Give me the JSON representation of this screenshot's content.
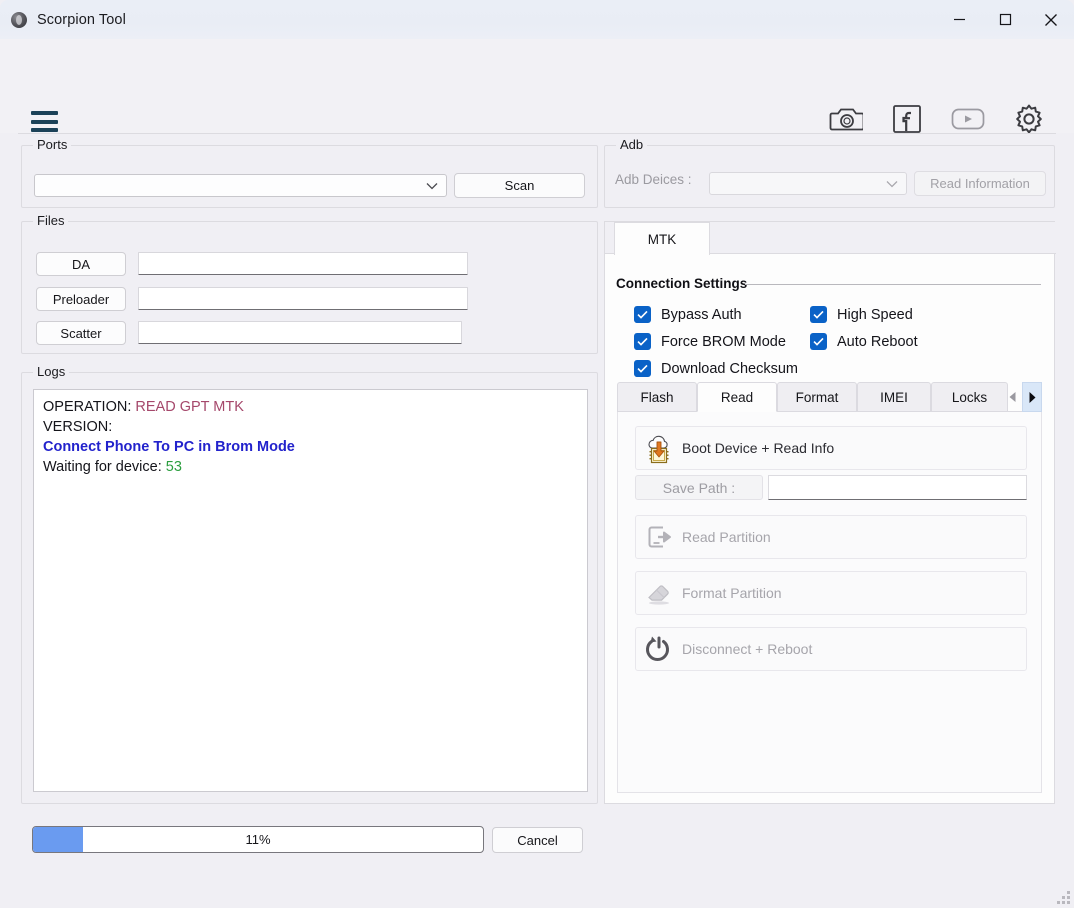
{
  "window": {
    "title": "Scorpion Tool",
    "icon": "app-logo-icon",
    "minimize": "minimize-icon",
    "maximize": "maximize-icon",
    "close": "close-icon"
  },
  "toolbar": {
    "menu_icon": "hamburger-menu-icon",
    "icons": [
      {
        "name": "camera-icon"
      },
      {
        "name": "facebook-icon"
      },
      {
        "name": "youtube-icon"
      },
      {
        "name": "gear-icon"
      }
    ]
  },
  "ports": {
    "legend": "Ports",
    "combo_value": "",
    "scan_label": "Scan"
  },
  "files": {
    "legend": "Files",
    "rows": [
      {
        "button": "DA",
        "value": ""
      },
      {
        "button": "Preloader",
        "value": ""
      },
      {
        "button": "Scatter",
        "value": ""
      }
    ]
  },
  "logs": {
    "legend": "Logs",
    "lines": [
      {
        "label": "OPERATION:",
        "value": "READ GPT MTK",
        "label_color": "#14141a",
        "value_color": "#a5486b"
      },
      {
        "label": "VERSION:",
        "value": "",
        "label_color": "#14141a",
        "value_color": "#14141a"
      },
      {
        "label": "Connect Phone To PC in Brom Mode",
        "value": "",
        "label_color": "#2222cc",
        "value_color": "#2222cc"
      },
      {
        "label": "Waiting for device:",
        "value": "53",
        "label_color": "#14141a",
        "value_color": "#2c9e3f"
      }
    ]
  },
  "adb": {
    "legend": "Adb",
    "devices_label": "Adb Deices :",
    "devices_value": "",
    "read_information_label": "Read Information"
  },
  "mtk": {
    "tab_label": "MTK",
    "connection_settings_legend": "Connection Settings",
    "checkboxes": [
      {
        "label": "Bypass Auth",
        "checked": true
      },
      {
        "label": "High Speed",
        "checked": true
      },
      {
        "label": "Force BROM Mode",
        "checked": true
      },
      {
        "label": "Auto Reboot",
        "checked": true
      },
      {
        "label": "Download Checksum",
        "checked": true
      }
    ],
    "inner_tabs": [
      {
        "label": "Flash",
        "active": false
      },
      {
        "label": "Read",
        "active": true
      },
      {
        "label": "Format",
        "active": false
      },
      {
        "label": "IMEI",
        "active": false
      },
      {
        "label": "Locks",
        "active": false
      }
    ],
    "tab_scroll_left_icon": "chevron-left-icon",
    "tab_scroll_right_icon": "chevron-right-icon",
    "read_pane": {
      "boot_device_label": "Boot Device + Read Info",
      "boot_device_icon": "cloud-download-chip-icon",
      "save_path_label": "Save Path :",
      "save_path_value": "",
      "read_partition_label": "Read Partition",
      "read_partition_icon": "phone-export-icon",
      "format_partition_label": "Format Partition",
      "format_partition_icon": "eraser-icon",
      "disconnect_reboot_label": "Disconnect +  Reboot",
      "disconnect_reboot_icon": "power-restart-icon"
    }
  },
  "bottom": {
    "progress_percent": "11%",
    "progress_value": 11,
    "cancel_label": "Cancel",
    "accent_color": "#6a9bf0"
  }
}
